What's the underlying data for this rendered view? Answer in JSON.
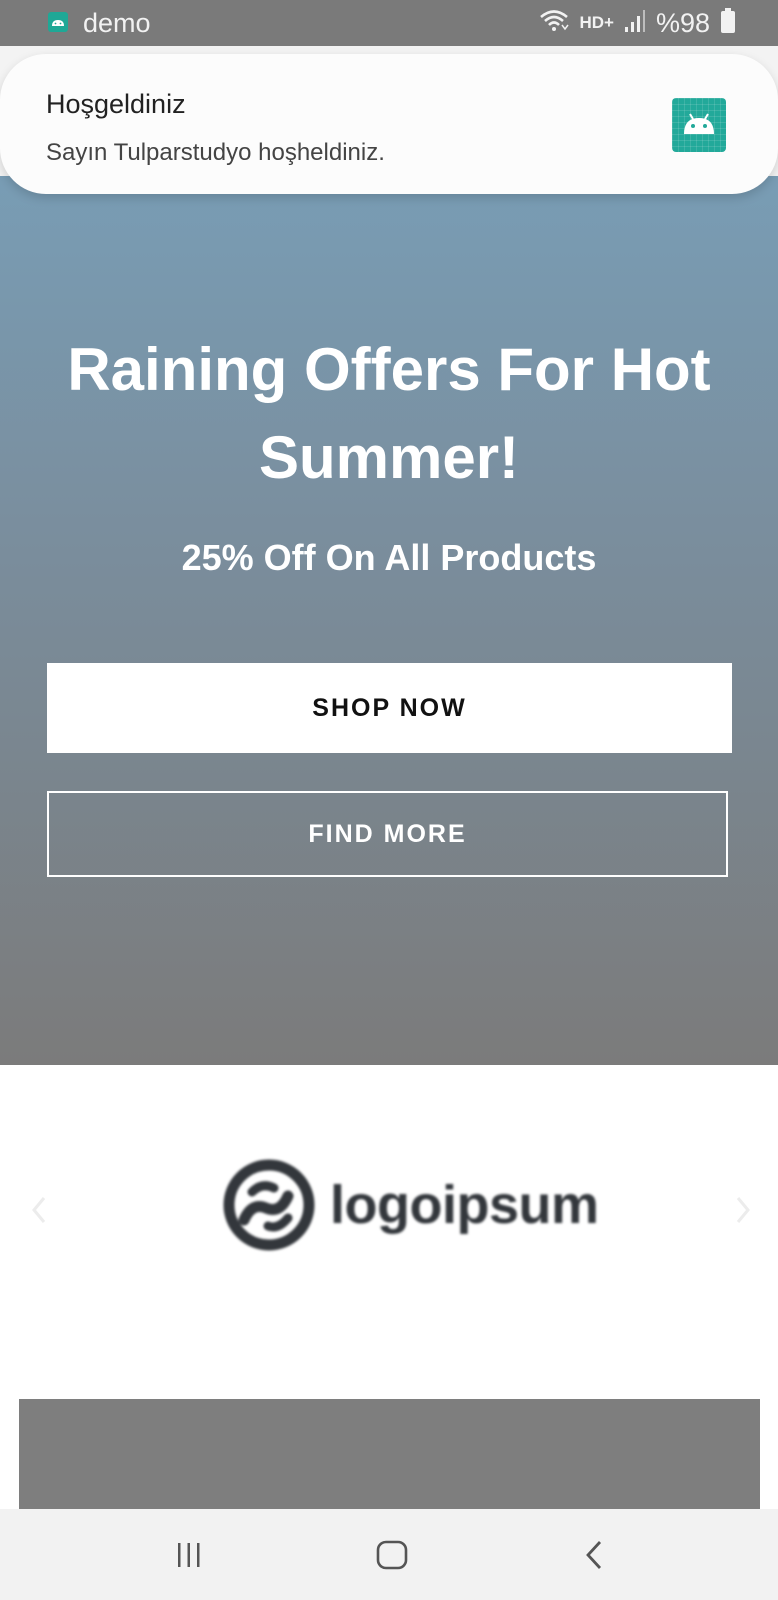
{
  "status_bar": {
    "app_name": "demo",
    "network_label": "HD+",
    "battery": "%98",
    "icons": [
      "android-icon",
      "wifi-icon",
      "signal-icon",
      "battery-icon"
    ]
  },
  "notification": {
    "title": "Hoşgeldiniz",
    "body": "Sayın Tulparstudyo hoşheldiniz.",
    "icon": "android-icon"
  },
  "hero": {
    "title": "Raining Offers For Hot Summer!",
    "subtitle": "25% Off On All Products",
    "primary_button": "SHOP NOW",
    "secondary_button": "FIND MORE"
  },
  "carousel": {
    "logo_text": "logoipsum",
    "prev_icon": "chevron-left-icon",
    "next_icon": "chevron-right-icon"
  },
  "nav_bar": {
    "icons": [
      "recents-icon",
      "home-icon",
      "back-icon"
    ]
  },
  "colors": {
    "status_bar": "#7a7a7a",
    "hero_top": "#78a2bd",
    "hero_bottom": "#7b7b7b",
    "app_icon": "#22a99a",
    "logo": "#33373c",
    "nav_bar": "#f2f2f2"
  }
}
